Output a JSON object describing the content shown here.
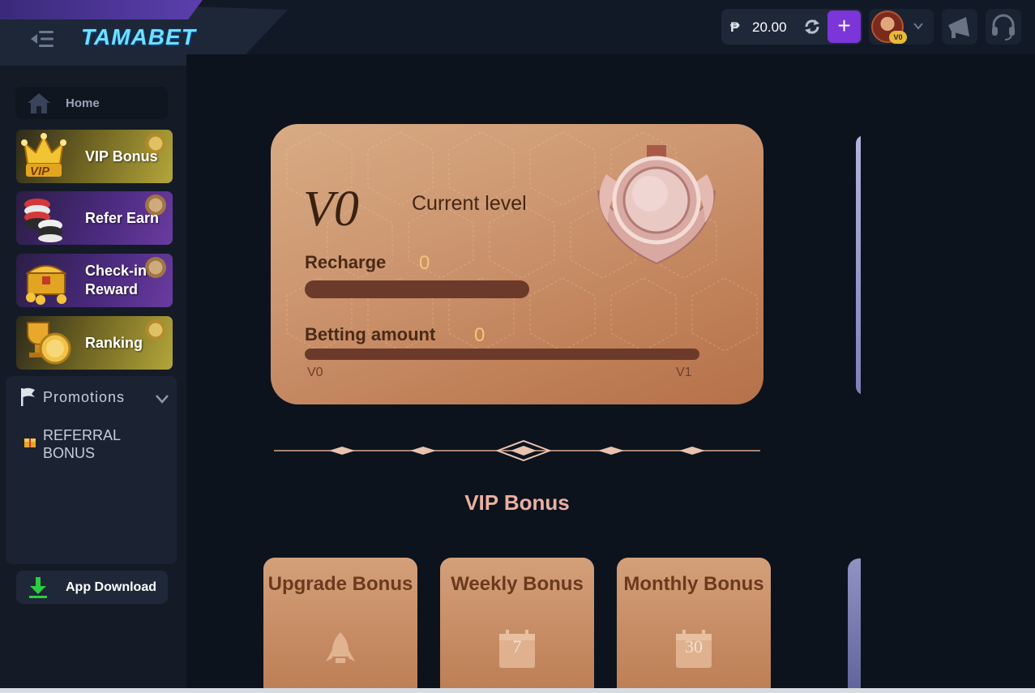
{
  "header": {
    "brand": "TAMABET",
    "currency_symbol": "₱",
    "balance": "20.00",
    "add_label": "+",
    "avatar_badge": "V0"
  },
  "sidebar": {
    "home_label": "Home",
    "promo_items": [
      {
        "label": "VIP Bonus",
        "icon": "crown-icon",
        "style": "gold"
      },
      {
        "label": "Refer Earn",
        "icon": "chips-icon",
        "style": "purple"
      },
      {
        "label": "Check-in Reward",
        "icon": "treasure-chest-icon",
        "style": "purple"
      },
      {
        "label": "Ranking",
        "icon": "trophy-icon",
        "style": "gold"
      }
    ],
    "promotions": {
      "title": "Promotions",
      "items": [
        {
          "label": "REFERRAL BONUS",
          "icon": "gift-icon"
        }
      ]
    },
    "app_download_label": "App Download"
  },
  "vip_card": {
    "level": "V0",
    "current_level_label": "Current level",
    "recharge_label": "Recharge",
    "recharge_value": "0",
    "recharge_progress": 0,
    "betting_label": "Betting amount",
    "betting_value": "0",
    "betting_progress": 0,
    "from_level": "V0",
    "to_level": "V1"
  },
  "section_title": "VIP Bonus",
  "bonus_cards": [
    {
      "title": "Upgrade Bonus",
      "icon": "rocket-icon",
      "number": ""
    },
    {
      "title": "Weekly Bonus",
      "icon": "calendar-icon",
      "number": "7"
    },
    {
      "title": "Monthly Bonus",
      "icon": "calendar-icon",
      "number": "30"
    }
  ],
  "colors": {
    "accent_purple": "#7b35d9",
    "card_bronze": "#c58a62",
    "background": "#0c131d",
    "value_gold": "#f5c676"
  }
}
